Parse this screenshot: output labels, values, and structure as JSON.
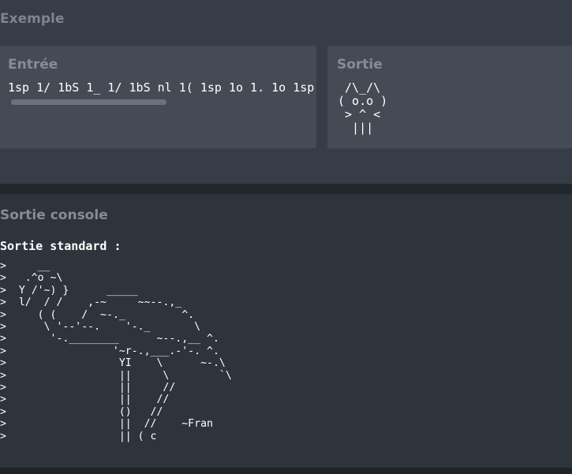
{
  "example": {
    "title": "Exemple",
    "input": {
      "title": "Entrée",
      "value": "1sp 1/ 1bS 1_ 1/ 1bS nl 1( 1sp 1o 1. 1o 1sp"
    },
    "output": {
      "title": "Sortie",
      "text": " /\\_/\\\n( o.o )\n > ^ <\n  |||"
    }
  },
  "console": {
    "title": "Sortie console",
    "stdout_label": "Sortie standard :",
    "lines": [
      ">     __",
      ">   .^o ~\\",
      ">  Y /'~) }      _____",
      ">  l/  / /    ,-~     ~~--.,_",
      ">     ( (    /  ~-._         ^.",
      ">      \\ '--'--.    '-._       \\",
      ">       '-.________      ~--.,__ ^.",
      ">                 '~r-.,___.-'-. ^.",
      ">                  YI    \\      ~-.\\",
      ">                  ||     \\        `\\",
      ">                  ||     //",
      ">                  ||    //",
      ">                  ()   //",
      ">                  ||  //    ~Fran",
      ">                  || ( c"
    ]
  }
}
